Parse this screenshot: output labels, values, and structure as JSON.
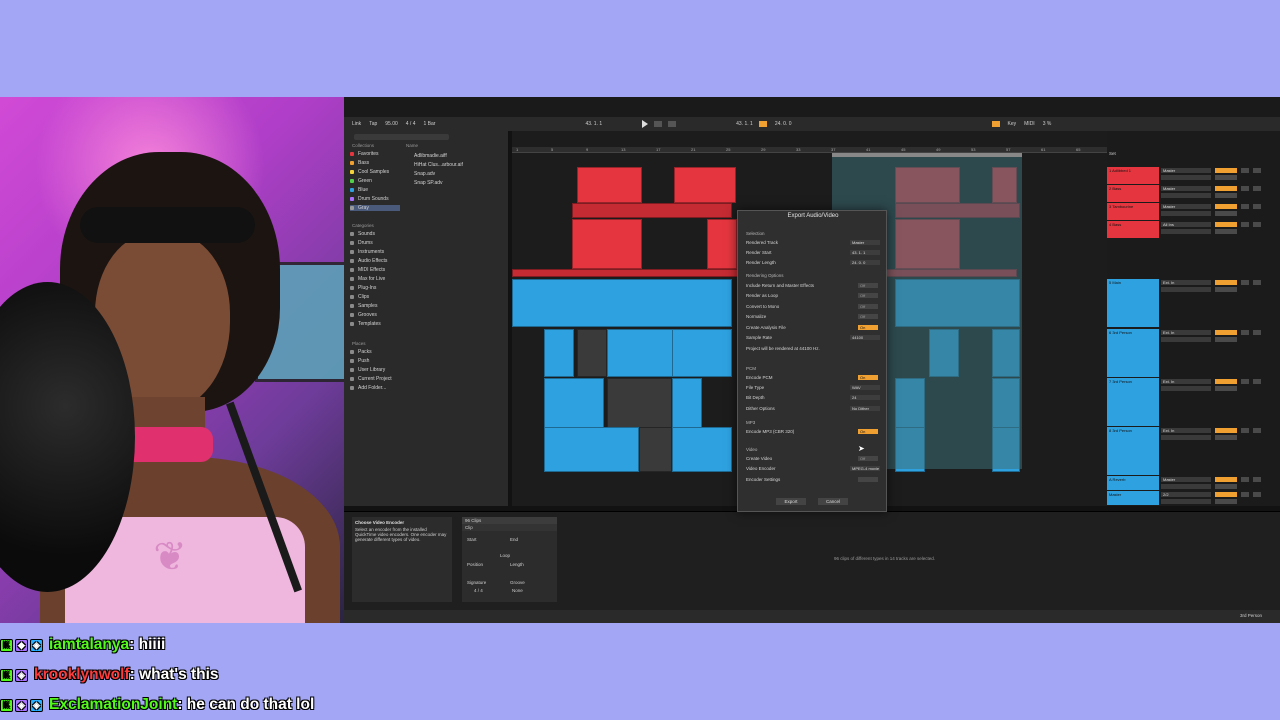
{
  "chat": [
    {
      "badges": [
        "K",
        "◆",
        "◈"
      ],
      "user": "iamtalanya",
      "text": " : hiiii",
      "color": "#53fc18"
    },
    {
      "badges": [
        "K",
        "◈"
      ],
      "user": "krooklynwolf",
      "text": " : what's this",
      "color": "#ff3c3c"
    },
    {
      "badges": [
        "K",
        "◈",
        "◈"
      ],
      "user": "ExclamationJoint",
      "text": " : he can do that lol",
      "color": "#53fc18"
    }
  ],
  "daw": {
    "transport": {
      "link": "Link",
      "tap": "Tap",
      "tempo": "95.00",
      "signature": "4 / 4",
      "bars": "1 Bar",
      "position": "43. 1. 1",
      "end": "24. 0. 0",
      "key": "Key",
      "midi": "MIDI",
      "cpu": "3 %"
    },
    "browser": {
      "search_placeholder": "Search (Cmd + F)",
      "collections_title": "Collections",
      "collections": [
        {
          "label": "Favorites",
          "color": "#e5363f"
        },
        {
          "label": "Bass",
          "color": "#f0a030"
        },
        {
          "label": "Cool Samples",
          "color": "#f5d23a"
        },
        {
          "label": "Green",
          "color": "#53d14a"
        },
        {
          "label": "Blue",
          "color": "#2ea2e1"
        },
        {
          "label": "Drum Sounds",
          "color": "#a970ff"
        },
        {
          "label": "Gray",
          "color": "#9a9a9a"
        }
      ],
      "categories_title": "Categories",
      "categories": [
        "Sounds",
        "Drums",
        "Instruments",
        "Audio Effects",
        "MIDI Effects",
        "Max for Live",
        "Plug-Ins",
        "Clips",
        "Samples",
        "Grooves",
        "Templates"
      ],
      "places_title": "Places",
      "places": [
        "Packs",
        "Push",
        "User Library",
        "Current Project",
        "Add Folder..."
      ],
      "name_header": "Name",
      "files": [
        "Adlibmadie.aiff",
        "HiHat Clus...arbour.aif",
        "Snap.adv",
        "Snap SP.adv"
      ]
    },
    "ruler_marks": [
      "1",
      "5",
      "9",
      "13",
      "17",
      "21",
      "25",
      "29",
      "33",
      "37",
      "41",
      "45",
      "49",
      "53",
      "57",
      "61",
      "65"
    ],
    "time_marks": [
      "0:00",
      "0:20",
      "0:40",
      "1:00",
      "1:20",
      "1:40",
      "2:00",
      "2:20",
      "2:40",
      "3:00",
      "3:20"
    ],
    "mixer": {
      "set_label": "Set",
      "tracks": [
        {
          "name": "1 Adlibbed 1",
          "routing": "Master",
          "color": "#e5363f"
        },
        {
          "name": "2 Bass",
          "routing": "Master",
          "color": "#e5363f"
        },
        {
          "name": "3 Tambourine",
          "routing": "Master",
          "color": "#e5363f"
        },
        {
          "name": "4 Bass",
          "routing": "All Ins",
          "color": "#e5363f"
        },
        {
          "name": "5 Main",
          "routing": "Ext. In",
          "color": "#2ea2e1"
        },
        {
          "name": "6 3rd Person",
          "routing": "Ext. In",
          "color": "#2ea2e1"
        },
        {
          "name": "7 3rd Person",
          "routing": "Ext. In",
          "color": "#2ea2e1"
        },
        {
          "name": "8 3rd Person",
          "routing": "Ext. In",
          "color": "#2ea2e1"
        },
        {
          "name": "A Reverb",
          "routing": "Master",
          "color": "#2ea2e1"
        },
        {
          "name": "Master",
          "routing": "2/2",
          "color": "#2ea2e1"
        }
      ]
    },
    "detail": {
      "info_title": "Choose Video Encoder",
      "info_text": "Select an encoder from the installed QuickTime video encoders. One encoder may generate different types of video.",
      "clip_header": "96 Clips",
      "clip_sub": "Clip",
      "start": "Start",
      "end": "End",
      "loop": "Loop",
      "position": "Position",
      "length": "Length",
      "signature": "Signature",
      "groove": "Groove",
      "sig_value": "4 / 4",
      "groove_value": "None",
      "message": "96 clips of different types in 14 tracks are selected.",
      "status_right": "3rd Person"
    },
    "dialog": {
      "title": "Export Audio/Video",
      "selection": "Selection",
      "rendered_track_label": "Rendered Track",
      "rendered_track_value": "Master",
      "render_start_label": "Render Start",
      "render_start_value": "43. 1. 1",
      "render_length_label": "Render Length",
      "render_length_value": "24. 0. 0",
      "rendering_options": "Rendering Options",
      "include_return": "Include Return and Master Effects",
      "render_loop": "Render as Loop",
      "convert_mono": "Convert to Mono",
      "normalize": "Normalize",
      "create_analysis": "Create Analysis File",
      "sample_rate_label": "Sample Rate",
      "sample_rate_value": "44100",
      "rendered_note": "Project will be rendered at 44100 Hz.",
      "pcm": "PCM",
      "encode_pcm": "Encode PCM",
      "file_type_label": "File Type",
      "file_type_value": "WAV",
      "bit_depth_label": "Bit Depth",
      "bit_depth_value": "24",
      "dither_label": "Dither Options",
      "dither_value": "No Dither",
      "mp3": "MP3",
      "encode_mp3": "Encode MP3 (CBR 320)",
      "video": "Video",
      "create_video": "Create Video",
      "video_encoder_label": "Video Encoder",
      "video_encoder_value": "MPEG-4 movie",
      "encoder_settings": "Encoder Settings",
      "on": "On",
      "off": "Off",
      "export_button": "Export",
      "cancel_button": "Cancel"
    }
  }
}
